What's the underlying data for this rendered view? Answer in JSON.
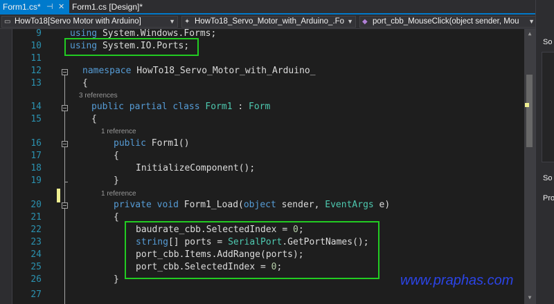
{
  "tabs": [
    {
      "label": "Form1.cs*",
      "active": true,
      "pin_icon": "pin-icon",
      "close_icon": "close-icon"
    },
    {
      "label": "Form1.cs [Design]*",
      "active": false
    }
  ],
  "nav": {
    "project": "HowTo18[Servo Motor with Arduino]",
    "class": "HowTo18_Servo_Motor_with_Arduino_.Fo",
    "member": "port_cbb_MouseClick(object sender, Mou"
  },
  "code": {
    "l9": {
      "n": "9",
      "using": "using",
      "rest": " System.Windows.Forms;"
    },
    "l10": {
      "n": "10",
      "using": "using",
      "rest": " System.IO.Ports;"
    },
    "l11": {
      "n": "11"
    },
    "l12": {
      "n": "12",
      "kw": "namespace",
      "rest": " HowTo18_Servo_Motor_with_Arduino_"
    },
    "l13": {
      "n": "13",
      "text": "{"
    },
    "lens14": "3 references",
    "l14": {
      "n": "14",
      "kw1": "public",
      "kw2": "partial",
      "kw3": "class",
      "type": "Form1",
      "colon": " : ",
      "base": "Form"
    },
    "l15": {
      "n": "15",
      "text": "{"
    },
    "lens16": "1 reference",
    "l16": {
      "n": "16",
      "kw": "public",
      "rest": " Form1()"
    },
    "l17": {
      "n": "17",
      "text": "{"
    },
    "l18": {
      "n": "18",
      "text": "InitializeComponent();"
    },
    "l19": {
      "n": "19",
      "text": "}"
    },
    "lens20": "1 reference",
    "l20": {
      "n": "20",
      "kw1": "private",
      "kw2": "void",
      "name": " Form1_Load(",
      "kw3": "object",
      "p1": " sender, ",
      "type": "EventArgs",
      "p2": " e)"
    },
    "l21": {
      "n": "21",
      "text": "{"
    },
    "l22": {
      "n": "22",
      "a": "baudrate_cbb.SelectedIndex = ",
      "num": "0",
      "b": ";"
    },
    "l23": {
      "n": "23",
      "kw": "string",
      "a": "[] ports = ",
      "type": "SerialPort",
      "b": ".GetPortNames();"
    },
    "l24": {
      "n": "24",
      "text": "port_cbb.Items.AddRange(ports);"
    },
    "l25": {
      "n": "25",
      "a": "port_cbb.SelectedIndex = ",
      "num": "0",
      "b": ";"
    },
    "l26": {
      "n": "26",
      "text": "}"
    },
    "l27": {
      "n": "27"
    }
  },
  "watermark": "www.praphas.com",
  "right_panel": {
    "item1": "So",
    "item2": "So",
    "item3": "Pro"
  },
  "colors": {
    "keyword": "#569cd6",
    "type": "#4ec9b0",
    "number": "#b5cea8",
    "line_number": "#2b91af",
    "highlight_box": "#22cc22",
    "watermark": "#2b44e6",
    "accent": "#007acc"
  }
}
